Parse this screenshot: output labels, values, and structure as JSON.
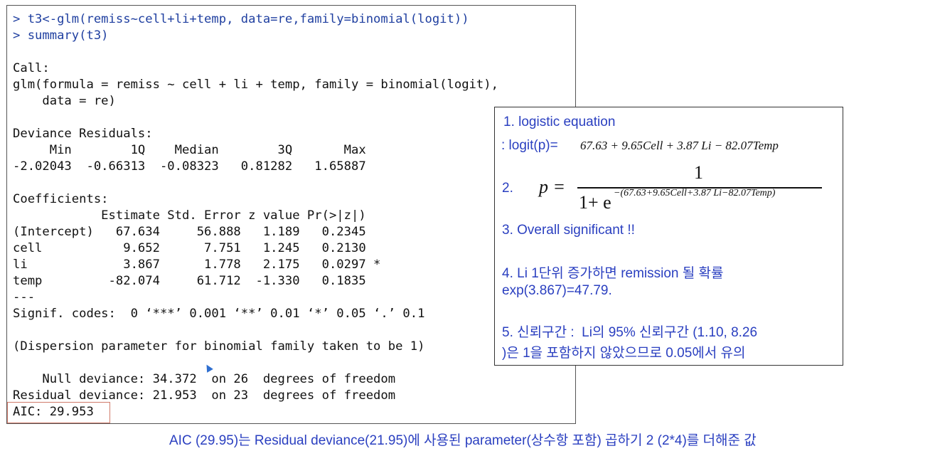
{
  "console": {
    "lines": [
      "> t3<-glm(remiss~cell+li+temp, data=re,family=binomial(logit))",
      "> summary(t3)",
      "",
      "Call:",
      "glm(formula = remiss ~ cell + li + temp, family = binomial(logit),",
      "    data = re)",
      "",
      "Deviance Residuals:",
      "     Min        1Q    Median        3Q       Max",
      "-2.02043  -0.66313  -0.08323   0.81282   1.65887",
      "",
      "Coefficients:",
      "            Estimate Std. Error z value Pr(>|z|)",
      "(Intercept)   67.634     56.888   1.189   0.2345",
      "cell           9.652      7.751   1.245   0.2130",
      "li             3.867      1.778   2.175   0.0297 *",
      "temp         -82.074     61.712  -1.330   0.1835",
      "---",
      "Signif. codes:  0 ‘***’ 0.001 ‘**’ 0.01 ‘*’ 0.05 ‘.’ 0.1",
      "",
      "(Dispersion parameter for binomial family taken to be 1)",
      "",
      "    Null deviance: 34.372  on 26  degrees of freedom",
      "Residual deviance: 21.953  on 23  degrees of freedom",
      "AIC: 29.953"
    ]
  },
  "notes": {
    "n1_label": "1. logistic equation",
    "n1_prefix": ": logit(p)=",
    "n1_formula": "67.63 + 9.65Cell + 3.87 Li − 82.07Temp",
    "n2_label": "2.",
    "n2_p": "p =",
    "n2_numerator": "1",
    "n2_den_base": "1+ e",
    "n2_den_exp": "−(67.63+9.65Cell+3.87 Li−82.07Temp)",
    "n3": "3. Overall significant !!",
    "n4_line1": "4. Li 1단위 증가하면 remission 될 확률",
    "n4_line2": "exp(3.867)=47.79.",
    "n5_line1": "5. 신뢰구간 :  Li의 95% 신뢰구간 (1.10, 8.26",
    "n5_line2": ")은 1을 포함하지 않았으므로 0.05에서 유의"
  },
  "footer": "AIC (29.95)는 Residual deviance(21.95)에 사용된 parameter(상수항 포함) 곱하기 2 (2*4)를 더해준 값"
}
